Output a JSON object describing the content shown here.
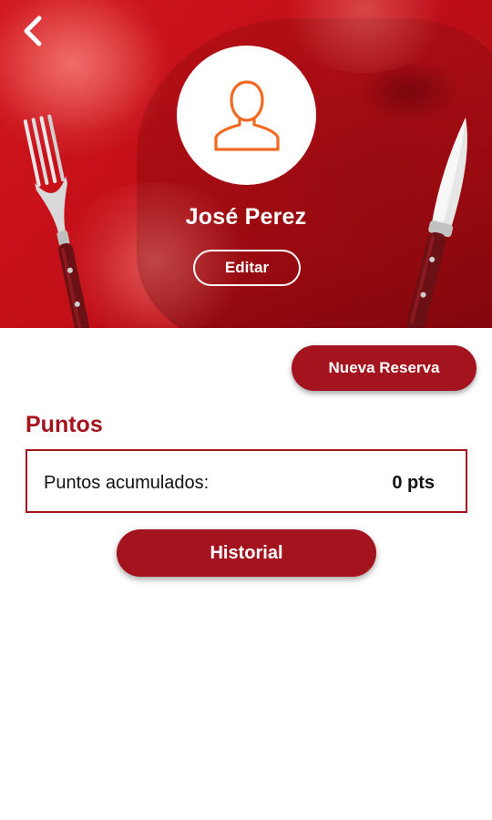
{
  "colors": {
    "brand_red": "#a3141e",
    "hero_red": "#c8121b",
    "avatar_icon": "#f26a21",
    "text_dark": "#111111",
    "white": "#ffffff"
  },
  "header": {
    "back_icon": "chevron-left-icon",
    "avatar_icon": "user-outline-icon"
  },
  "profile": {
    "name": "José Perez",
    "edit_label": "Editar"
  },
  "actions": {
    "new_reservation_label": "Nueva Reserva",
    "history_label": "Historial"
  },
  "points": {
    "section_title": "Puntos",
    "label": "Puntos acumulados:",
    "value": "0 pts"
  }
}
